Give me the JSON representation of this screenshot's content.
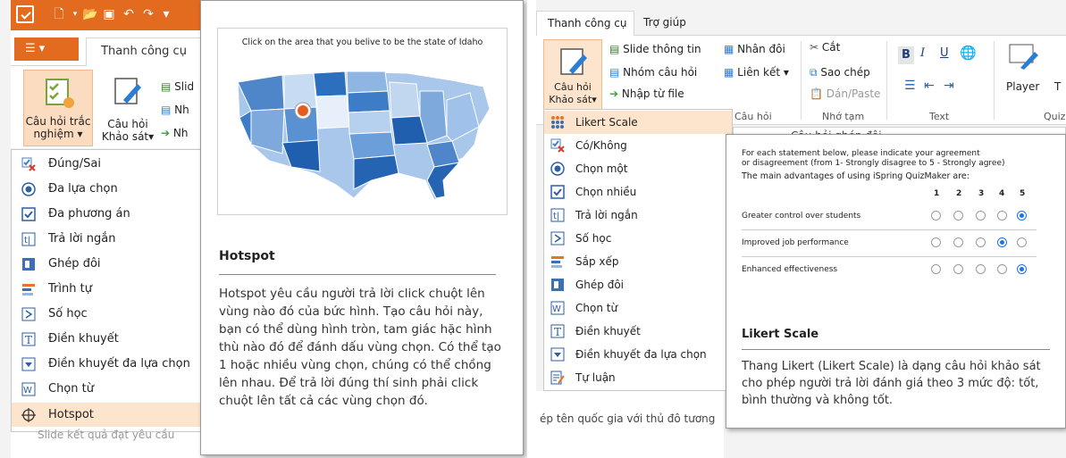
{
  "left": {
    "ribbon": {
      "file_menu_label": "",
      "tab_tools": "Thanh công cụ",
      "btn_quiz_line1": "Câu hỏi trắc",
      "btn_quiz_line2": "nghiệm ▾",
      "btn_survey_line1": "Câu hỏi",
      "btn_survey_line2": "Khảo sát▾",
      "small1": "Slid",
      "small2": "Nh",
      "small3": "Nh"
    },
    "menu": [
      {
        "label": "Đúng/Sai",
        "icon": "true-false-icon"
      },
      {
        "label": "Đa lựa chọn",
        "icon": "radio-icon"
      },
      {
        "label": "Đa phương án",
        "icon": "checkbox-icon"
      },
      {
        "label": "Trả lời ngắn",
        "icon": "short-answer-icon"
      },
      {
        "label": "Ghép đôi",
        "icon": "matching-icon"
      },
      {
        "label": "Trình tự",
        "icon": "sequence-icon"
      },
      {
        "label": "Số học",
        "icon": "numeric-icon"
      },
      {
        "label": "Điền khuyết",
        "icon": "fill-blank-icon"
      },
      {
        "label": "Điền khuyết đa lựa chọn",
        "icon": "dropdown-icon"
      },
      {
        "label": "Chọn từ",
        "icon": "word-bank-icon"
      },
      {
        "label": "Hotspot",
        "icon": "hotspot-icon"
      }
    ],
    "active_index": 10,
    "bottom_text": "Slide kết quả đạt yêu cầu",
    "tooltip": {
      "preview_caption": "Click on the area that you belive to be the state of Idaho",
      "title": "Hotspot",
      "description": "Hotspot yêu cầu người trả lời click chuột lên vùng nào đó của bức hình. Tạo câu hỏi này, bạn có thể dùng hình tròn, tam giác hặc hình thù nào đó để đánh dấu vùng chọn. Có thể tạo 1 hoặc nhiều vùng chọn, chúng có thể chồng lên nhau. Để trả lời đúng thí sinh phải click chuột lên tất cả các vùng chọn đó."
    }
  },
  "right": {
    "tabs": {
      "tools": "Thanh công cụ",
      "help": "Trợ giúp"
    },
    "ribbon": {
      "btn_survey_line1": "Câu hỏi",
      "btn_survey_line2": "Khảo sát▾",
      "slide_info": "Slide thông tin",
      "group_questions": "Nhóm câu hỏi",
      "import_file": "Nhập từ file",
      "duplicate": "Nhân đôi",
      "link": "Liên kết ▾",
      "cut": "Cắt",
      "copy": "Sao chép",
      "paste": "Dán/Paste",
      "group_label_question": "Câu hỏi",
      "group_label_clipboard": "Nhớ tạm",
      "group_label_text": "Text",
      "bold": "B",
      "italic": "I",
      "underline": "U",
      "player": "Player",
      "t_label": "T",
      "quiz_label": "Quiz"
    },
    "menu": [
      {
        "label": "Likert Scale",
        "icon": "likert-icon"
      },
      {
        "label": "Có/Không",
        "icon": "yes-no-icon"
      },
      {
        "label": "Chọn một",
        "icon": "radio-icon"
      },
      {
        "label": "Chọn nhiều",
        "icon": "checkbox-icon"
      },
      {
        "label": "Trả lời ngắn",
        "icon": "short-answer-icon"
      },
      {
        "label": "Số học",
        "icon": "numeric-icon"
      },
      {
        "label": "Sắp xếp",
        "icon": "ranking-icon"
      },
      {
        "label": "Ghép đôi",
        "icon": "matching-icon"
      },
      {
        "label": "Chọn từ",
        "icon": "word-bank-icon"
      },
      {
        "label": "Điền khuyết",
        "icon": "fill-blank-icon"
      },
      {
        "label": "Điền khuyết đa lựa chọn",
        "icon": "dropdown-icon"
      },
      {
        "label": "Tự luận",
        "icon": "essay-icon"
      }
    ],
    "active_index": 0,
    "background_header": "Câu hỏi ghép đôi",
    "bottom_text": "ép tên quốc gia với thủ đô tương",
    "tooltip": {
      "preview": {
        "instruction1": "For each statement below, please indicate your agreement",
        "instruction2": "or disagreement (from 1- Strongly disagree to 5 - Strongly agree)",
        "question": "The main advantages of using iSpring QuizMaker are:",
        "scale": [
          "1",
          "2",
          "3",
          "4",
          "5"
        ],
        "rows": [
          {
            "label": "Greater control over students",
            "selected": 5
          },
          {
            "label": "Improved job performance",
            "selected": 4
          },
          {
            "label": "Enhanced effectiveness",
            "selected": 5
          }
        ]
      },
      "title": "Likert Scale",
      "description": "Thang Likert (Likert Scale) là dạng câu hỏi khảo sát cho phép người trả lời đánh giá theo 3 mức độ: tốt, bình thường và không tốt."
    }
  }
}
